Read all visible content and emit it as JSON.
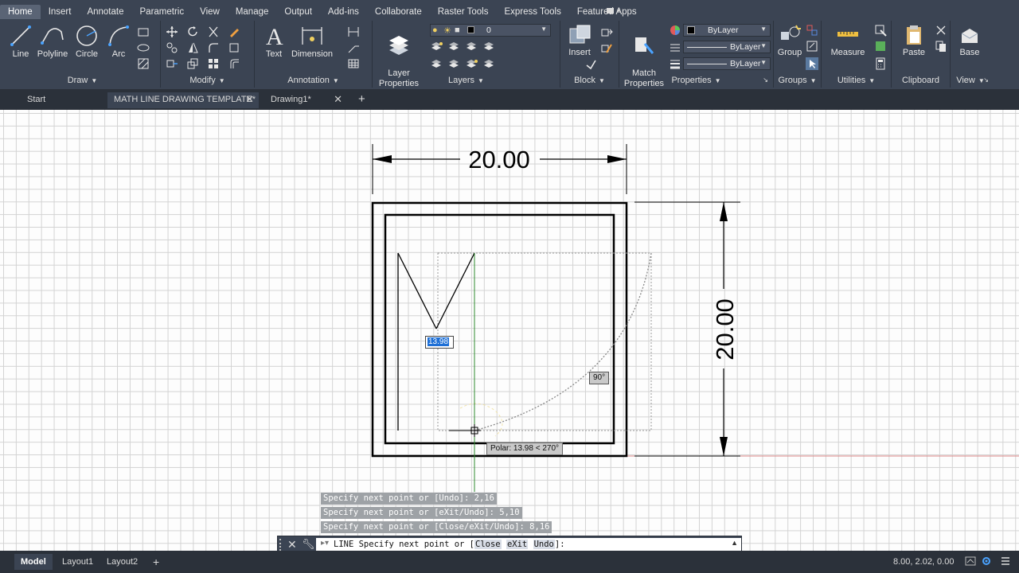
{
  "ribbon": {
    "tabs": [
      "Home",
      "Insert",
      "Annotate",
      "Parametric",
      "View",
      "Manage",
      "Output",
      "Add-ins",
      "Collaborate",
      "Raster Tools",
      "Express Tools",
      "Featured Apps"
    ],
    "active_tab": "Home",
    "draw": {
      "title": "Draw",
      "line": "Line",
      "polyline": "Polyline",
      "circle": "Circle",
      "arc": "Arc"
    },
    "modify": {
      "title": "Modify"
    },
    "annotation": {
      "title": "Annotation",
      "text": "Text",
      "dimension": "Dimension"
    },
    "layers": {
      "title": "Layers",
      "layer_properties": "Layer\nProperties",
      "current_layer": "0"
    },
    "block": {
      "title": "Block",
      "insert": "Insert"
    },
    "properties": {
      "title": "Properties",
      "match": "Match\nProperties",
      "color": "ByLayer",
      "linetype": "ByLayer",
      "lineweight": "ByLayer"
    },
    "groups": {
      "title": "Groups",
      "group": "Group"
    },
    "utilities": {
      "title": "Utilities",
      "measure": "Measure"
    },
    "clipboard": {
      "title": "Clipboard",
      "paste": "Paste"
    },
    "view": {
      "title": "View",
      "base": "Base"
    }
  },
  "file_tabs": {
    "start": "Start",
    "tabs": [
      "MATH LINE DRAWING TEMPLATE*",
      "Drawing1*"
    ],
    "active": "MATH LINE DRAWING TEMPLATE*"
  },
  "drawing": {
    "dim_horizontal": "20.00",
    "dim_vertical": "20.00",
    "dynamic_input_value": "13.98",
    "angle_tooltip": "90°",
    "polar_tooltip": "Polar: 13.98 < 270°"
  },
  "command": {
    "history": [
      "Specify next point or [Undo]: 2,16",
      "Specify next point or [eXit/Undo]: 5,10",
      "Specify next point or [Close/eXit/Undo]: 8,16"
    ],
    "prompt_prefix": "LINE Specify next point or [",
    "options": [
      "Close",
      "eXit",
      "Undo"
    ],
    "prompt_suffix": "]:"
  },
  "status": {
    "layout_tabs": [
      "Model",
      "Layout1",
      "Layout2"
    ],
    "active_layout": "Model",
    "add_layout": "+",
    "coordinates": "8.00, 2.02, 0.00"
  },
  "colors": {
    "ribbon_bg": "#3b4453",
    "tab_bar_bg": "#2b313a",
    "grid_line": "#d3d3d3",
    "selection_blue": "#1d6fd6",
    "tracking_green": "#2e8b2e",
    "polar_yellow": "#f0d060"
  }
}
